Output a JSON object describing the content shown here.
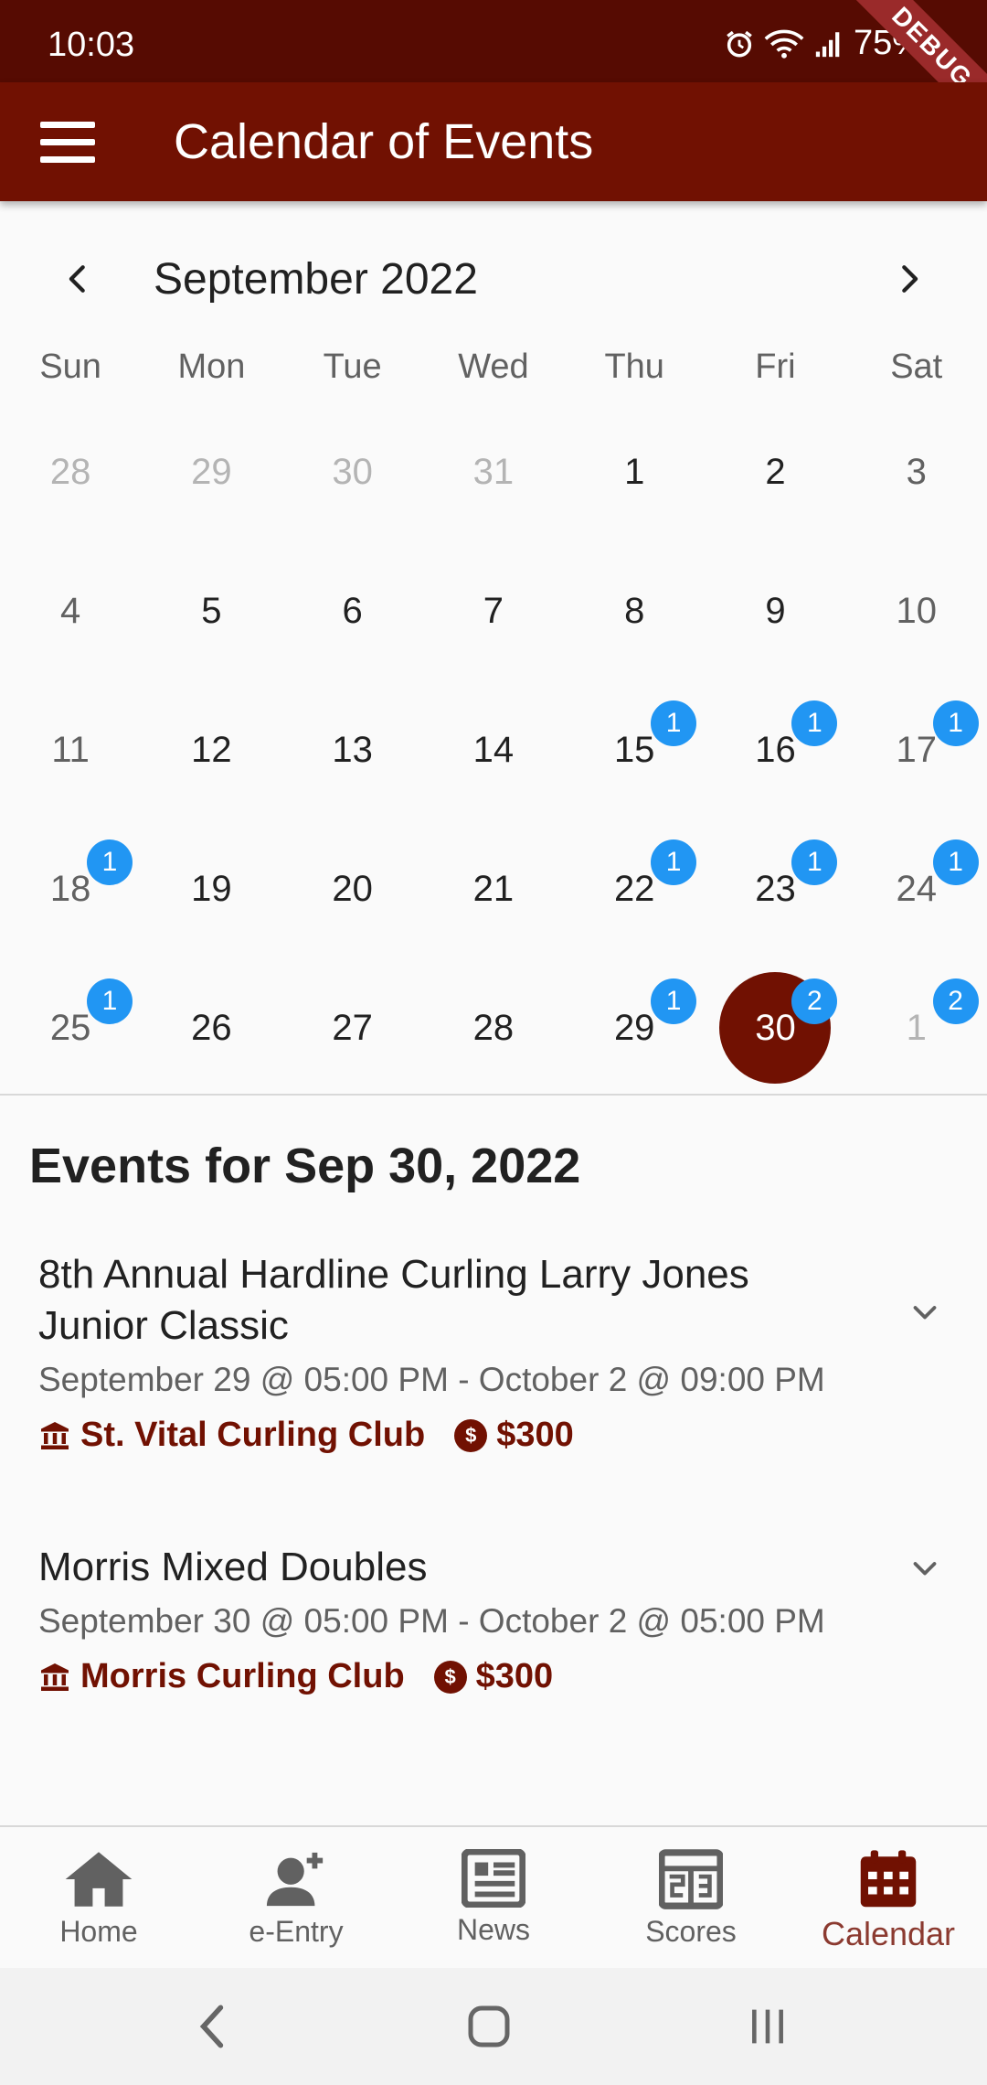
{
  "status": {
    "time": "10:03",
    "battery": "75%",
    "debug": "DEBUG"
  },
  "app_bar": {
    "title": "Calendar of Events",
    "menu_icon": "menu-icon"
  },
  "calendar": {
    "month_label": "September 2022",
    "weekdays": [
      "Sun",
      "Mon",
      "Tue",
      "Wed",
      "Thu",
      "Fri",
      "Sat"
    ],
    "weeks": [
      [
        {
          "d": "28",
          "out": true
        },
        {
          "d": "29",
          "out": true
        },
        {
          "d": "30",
          "out": true
        },
        {
          "d": "31",
          "out": true
        },
        {
          "d": "1"
        },
        {
          "d": "2"
        },
        {
          "d": "3"
        }
      ],
      [
        {
          "d": "4"
        },
        {
          "d": "5"
        },
        {
          "d": "6"
        },
        {
          "d": "7"
        },
        {
          "d": "8"
        },
        {
          "d": "9"
        },
        {
          "d": "10"
        }
      ],
      [
        {
          "d": "11"
        },
        {
          "d": "12"
        },
        {
          "d": "13"
        },
        {
          "d": "14"
        },
        {
          "d": "15",
          "badge": "1"
        },
        {
          "d": "16",
          "badge": "1"
        },
        {
          "d": "17",
          "badge": "1"
        }
      ],
      [
        {
          "d": "18",
          "badge": "1"
        },
        {
          "d": "19"
        },
        {
          "d": "20"
        },
        {
          "d": "21"
        },
        {
          "d": "22",
          "badge": "1"
        },
        {
          "d": "23",
          "badge": "1"
        },
        {
          "d": "24",
          "badge": "1"
        }
      ],
      [
        {
          "d": "25",
          "badge": "1"
        },
        {
          "d": "26"
        },
        {
          "d": "27"
        },
        {
          "d": "28"
        },
        {
          "d": "29",
          "badge": "1"
        },
        {
          "d": "30",
          "badge": "2",
          "selected": true
        },
        {
          "d": "1",
          "badge": "2",
          "out": true
        }
      ]
    ],
    "colors": {
      "selected": "#711102",
      "badge": "#2196f3"
    }
  },
  "events": {
    "heading": "Events for Sep 30, 2022",
    "items": [
      {
        "title": "8th Annual Hardline Curling Larry Jones Junior Classic",
        "dates": "September 29 @ 05:00 PM - October 2 @ 09:00 PM",
        "venue": "St. Vital Curling Club",
        "fee": "$300"
      },
      {
        "title": "Morris Mixed Doubles",
        "dates": "September 30 @ 05:00 PM - October 2 @ 05:00 PM",
        "venue": "Morris Curling Club",
        "fee": "$300"
      }
    ]
  },
  "bottom_nav": {
    "items": [
      {
        "label": "Home",
        "icon": "home-icon"
      },
      {
        "label": "e-Entry",
        "icon": "person-add-icon"
      },
      {
        "label": "News",
        "icon": "newspaper-icon"
      },
      {
        "label": "Scores",
        "icon": "scoreboard-icon"
      },
      {
        "label": "Calendar",
        "icon": "calendar-icon",
        "active": true
      }
    ],
    "active_color": "#711102"
  }
}
